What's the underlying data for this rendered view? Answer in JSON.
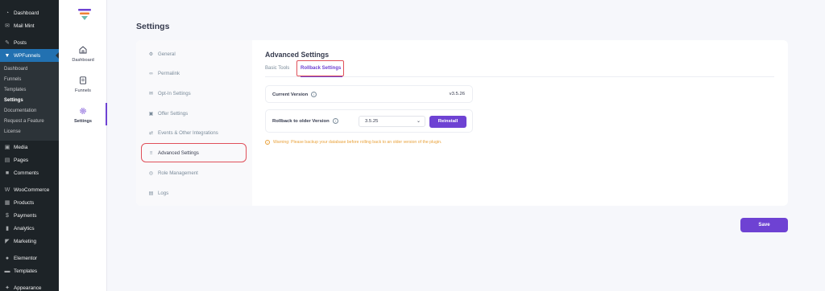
{
  "wp_sidebar": {
    "items": [
      {
        "label": "Dashboard",
        "icon": "dashboard-icon"
      },
      {
        "label": "Mail Mint",
        "icon": "mail-icon"
      },
      {
        "label": "Posts",
        "icon": "pin-icon"
      },
      {
        "label": "WPFunnels",
        "icon": "funnel-icon"
      }
    ],
    "sub_items": [
      "Dashboard",
      "Funnels",
      "Templates",
      "Settings",
      "Documentation",
      "Request a Feature",
      "License"
    ],
    "items_after": [
      {
        "label": "Media",
        "icon": "media-icon"
      },
      {
        "label": "Pages",
        "icon": "pages-icon"
      },
      {
        "label": "Comments",
        "icon": "comments-icon"
      },
      {
        "label": "WooCommerce",
        "icon": "woocommerce-icon"
      },
      {
        "label": "Products",
        "icon": "products-icon"
      },
      {
        "label": "Payments",
        "icon": "payments-icon"
      },
      {
        "label": "Analytics",
        "icon": "analytics-icon"
      },
      {
        "label": "Marketing",
        "icon": "marketing-icon"
      },
      {
        "label": "Elementor",
        "icon": "elementor-icon"
      },
      {
        "label": "Templates",
        "icon": "templates-icon"
      },
      {
        "label": "Appearance",
        "icon": "appearance-icon"
      }
    ]
  },
  "plugin_rail": {
    "items": [
      {
        "label": "Dashboard",
        "icon": "home-icon"
      },
      {
        "label": "Funnels",
        "icon": "document-icon"
      },
      {
        "label": "Settings",
        "icon": "gear-icon"
      }
    ]
  },
  "page": {
    "title": "Settings"
  },
  "settings_nav": {
    "items": [
      {
        "label": "General",
        "icon": "gear-icon"
      },
      {
        "label": "Permalink",
        "icon": "link-icon"
      },
      {
        "label": "Opt-In Settings",
        "icon": "envelope-icon"
      },
      {
        "label": "Offer Settings",
        "icon": "gift-icon"
      },
      {
        "label": "Events & Other Integrations",
        "icon": "integrations-icon"
      },
      {
        "label": "Advanced Settings",
        "icon": "sliders-icon"
      },
      {
        "label": "Role Management",
        "icon": "user-icon"
      },
      {
        "label": "Logs",
        "icon": "log-icon"
      }
    ]
  },
  "advanced": {
    "title": "Advanced Settings",
    "tabs": [
      "Basic Tools",
      "Rollback Settings"
    ],
    "current_version_label": "Current Version",
    "current_version_value": "v3.5.26",
    "rollback_label": "Rollback to older Version",
    "rollback_selected": "3.5.25",
    "reinstall_label": "Reinstall",
    "warning": "Warning: Please backup your database before rolling back to an older version of the plugin."
  },
  "save_label": "Save",
  "colors": {
    "accent": "#6e42d3",
    "wp_sidebar": "#1d2327",
    "wp_active": "#2271b1",
    "warning": "#e9a23b",
    "highlight": "#e0505a"
  }
}
